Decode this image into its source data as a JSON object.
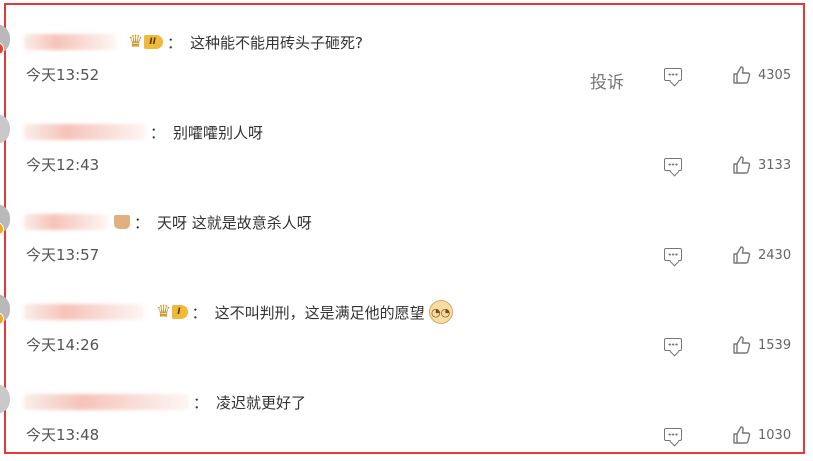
{
  "comments": [
    {
      "user_level": "II",
      "separator": "：",
      "text": "这种能不能用砖头子砸死?",
      "time": "今天13:52",
      "report_label": "投诉",
      "likes": "4305"
    },
    {
      "separator": "：",
      "text": "别嚯嚯别人呀",
      "time": "今天12:43",
      "likes": "3133"
    },
    {
      "separator": "：",
      "text": "天呀 这就是故意杀人呀",
      "time": "今天13:57",
      "likes": "2430"
    },
    {
      "user_level": "I",
      "separator": "：",
      "text": "这不叫判刑，这是满足他的愿望",
      "time": "今天14:26",
      "likes": "1539"
    },
    {
      "separator": "：",
      "text": "凌迟就更好了",
      "time": "今天13:48",
      "likes": "1030"
    }
  ],
  "icons": {
    "reply": "comment-icon",
    "like": "thumbs-up-icon",
    "level": "crown-badge-icon",
    "emoji": "doge-emoji-icon"
  },
  "colors": {
    "highlight_border": "#e53935",
    "badge_gold": "#f0b93a",
    "verified_orange": "#f5a623",
    "verified_red": "#e8412c"
  }
}
